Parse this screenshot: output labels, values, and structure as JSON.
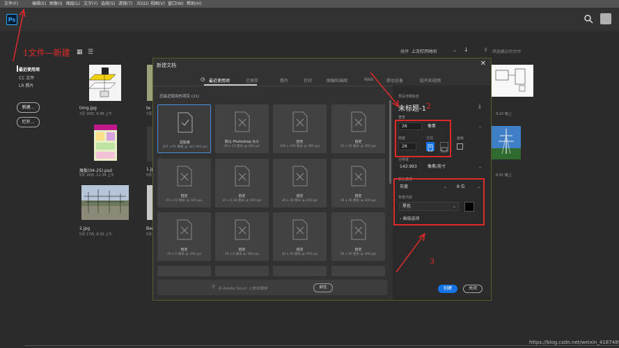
{
  "menubar": [
    "文件(F)",
    "编辑(E)",
    "图像(I)",
    "图层(L)",
    "文字(Y)",
    "选择(S)",
    "滤镜(T)",
    "3D(D)",
    "视图(V)",
    "窗口(W)",
    "帮助(H)"
  ],
  "app": {
    "logo": "Ps"
  },
  "nav": {
    "recent": "最近使用项",
    "cc_files": "CC 文件",
    "lr_photos": "LR 照片",
    "new_button": "新建...",
    "open_button": "打开..."
  },
  "sort": {
    "label": "排序",
    "value": "上次打开时间",
    "filter_placeholder": "筛选最近的文件"
  },
  "recent_files": [
    {
      "name": "timg.jpg",
      "date": "7月 18日, 9:48 上午"
    },
    {
      "name": "te",
      "date": "7月"
    },
    {
      "name": "",
      "date": "9:10 晚上"
    },
    {
      "name": "展板(04-25).psd",
      "date": "5月 18日, 11:34 上午"
    },
    {
      "name": "1.jp",
      "date": "5月"
    },
    {
      "name": "",
      "date": "6:01 晚上"
    },
    {
      "name": "2.jpg",
      "date": "5月 17日, 9:39 上午"
    },
    {
      "name": "Bac",
      "date": "5月"
    }
  ],
  "annotations": {
    "step1": "1文件—新建",
    "step2": "2",
    "step3": "3"
  },
  "dialog": {
    "title": "新建文档",
    "close": "✕",
    "tabs": [
      "最近使用项",
      "已保存",
      "照片",
      "打印",
      "图稿和插图",
      "Web",
      "移动设备",
      "胶片和视频"
    ],
    "recent_heading": "您最近使用的项目",
    "recent_count": "(21)",
    "presets": [
      {
        "name": "剪贴板",
        "size": "307 x 93 像素 @ 143.993 ppi"
      },
      {
        "name": "默认 Photoshop 大小",
        "size": "16 x 12 厘米 @ 300 ppi"
      },
      {
        "name": "自定",
        "size": "100 x 100 厘米 @ 300 ppi"
      },
      {
        "name": "自定",
        "size": "25 x 25 厘米 @ 300 ppi"
      },
      {
        "name": "自定",
        "size": "25 x 25 厘米 @ 300 ppi"
      },
      {
        "name": "自定",
        "size": "25 x 0.28 厘米 @ 300 ppi"
      },
      {
        "name": "自定",
        "size": "28 x 28 厘米 @ 300 ppi"
      },
      {
        "name": "自定",
        "size": "28 x 28 厘米 @ 300 ppi"
      },
      {
        "name": "自定",
        "size": "20 x 5 厘米 @ 300 ppi"
      },
      {
        "name": "自定",
        "size": "20 x 6 厘米 @ 300 ppi"
      },
      {
        "name": "自定",
        "size": "20 x 20 厘米 @ 300 ppi"
      },
      {
        "name": "自定",
        "size": "30 x 30 厘米 @ 300 ppi"
      }
    ],
    "stock_placeholder": "在 Adobe Stock 上查找模板",
    "go_button": "前往",
    "details": {
      "heading": "预设详细信息",
      "doc_name": "未标题-1",
      "width_label": "宽度",
      "width_value": "28",
      "width_unit": "像素",
      "height_label": "高度",
      "height_value": "28",
      "orientation_label": "方向",
      "artboard_label": "画板",
      "resolution_label": "分辨率",
      "resolution_value": "143.993",
      "resolution_unit": "像素/英寸",
      "color_mode_label": "颜色模式",
      "color_mode": "灰度",
      "bit_depth": "8 位",
      "bg_label": "背景内容",
      "bg_value": "黑色",
      "advanced": "高级选项",
      "create_button": "创建",
      "close_button": "关闭"
    }
  },
  "watermark": "https://blog.csdn.net/weixin_41874898",
  "colors": {
    "accent": "#31a8ff",
    "annotation": "#e02a2a",
    "create": "#1473e6"
  }
}
